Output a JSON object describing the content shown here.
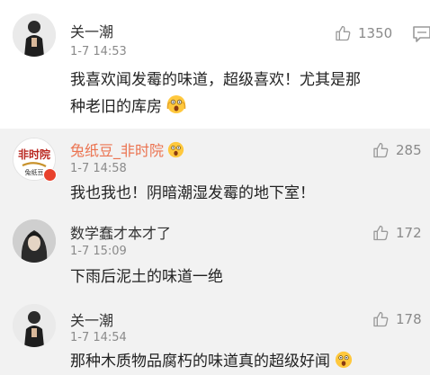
{
  "comments": [
    {
      "author": "关一潮",
      "time": "1-7 14:53",
      "likes": "1350",
      "text": "我喜欢闻发霉的味道，超级喜欢！尤其是那种老旧的库房",
      "line1": "我喜欢闻发霉的味道，超级喜欢！尤其是那",
      "line2": "种老旧的库房",
      "avatar_icon": "person-photo-icon",
      "emoji_icon": "surprised-face-emoji"
    },
    {
      "author": "兔纸豆_非时院",
      "time": "1-7 14:58",
      "likes": "285",
      "text": "我也我也！阴暗潮湿发霉的地下室！",
      "author_color": "#eb7350",
      "avatar_icon": "calligraphy-avatar-icon",
      "badge_icon": "surprised-face-emoji"
    },
    {
      "author": "数学蠢才本才了",
      "time": "1-7 15:09",
      "likes": "172",
      "text": "下雨后泥土的味道一绝",
      "avatar_icon": "person-photo-icon"
    },
    {
      "author": "关一潮",
      "time": "1-7 14:54",
      "likes": "178",
      "text": "那种木质物品腐朽的味道真的超级好闻",
      "avatar_icon": "person-photo-icon",
      "emoji_icon": "surprised-face-emoji"
    }
  ],
  "icons": {
    "like": "thumbs-up-icon",
    "comment": "comment-icon"
  },
  "colors": {
    "author_highlight": "#eb7350",
    "time": "#8a8a8a",
    "secondary_bg": "#f2f2f2"
  }
}
